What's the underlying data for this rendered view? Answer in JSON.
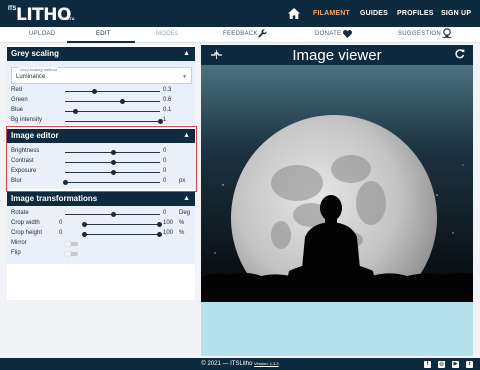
{
  "nav": {
    "logo_its": "ITS",
    "logo_litho": "LITHO",
    "logo_beta": "BETA",
    "links": [
      "FILAMENT",
      "GUIDES",
      "PROFILES",
      "SIGN UP"
    ]
  },
  "tabs": {
    "upload": "UPLOAD",
    "edit": "EDIT",
    "model": "MODEL",
    "feedback": "FEEDBACK",
    "donate": "DONATE",
    "suggestion": "SUGGESTION"
  },
  "grey": {
    "title": "Grey scaling",
    "method_label": "Grey-scaling method",
    "method_value": "Luminance",
    "sliders": [
      {
        "label": "Red",
        "value": "0.3",
        "fraction": 0.3
      },
      {
        "label": "Green",
        "value": "0.6",
        "fraction": 0.6
      },
      {
        "label": "Blue",
        "value": "0.1",
        "fraction": 0.1
      },
      {
        "label": "Bg intensity",
        "value": "1",
        "fraction": 1.0
      }
    ]
  },
  "editor": {
    "title": "Image editor",
    "sliders": [
      {
        "label": "Brightness",
        "value": "0",
        "fraction": 0.5,
        "unit": ""
      },
      {
        "label": "Contrast",
        "value": "0",
        "fraction": 0.5,
        "unit": ""
      },
      {
        "label": "Exposure",
        "value": "0",
        "fraction": 0.5,
        "unit": ""
      },
      {
        "label": "Blur",
        "value": "0",
        "fraction": 0.0,
        "unit": "px"
      }
    ]
  },
  "transform": {
    "title": "Image transformations",
    "rotate": {
      "label": "Rotate",
      "value": "0",
      "unit": "Deg",
      "fraction": 0.5
    },
    "crop_width": {
      "label": "Crop width",
      "min": "0",
      "max": "100",
      "unit": "%"
    },
    "crop_height": {
      "label": "Crop height",
      "min": "0",
      "max": "100",
      "unit": "%"
    },
    "mirror": {
      "label": "Mirror",
      "on": false
    },
    "flip": {
      "label": "Flip",
      "on": false
    }
  },
  "viewer": {
    "title": "Image viewer"
  },
  "footer": {
    "copyright": "© 2021 — ITSLitho",
    "version": "Version: 1.3.3"
  },
  "colors": {
    "navy": "#0e2a3f",
    "accent": "#f2a36b",
    "panel_bg": "#e9f0f9",
    "highlight": "#d64545",
    "viewer_bottom": "#b5e1ef"
  }
}
